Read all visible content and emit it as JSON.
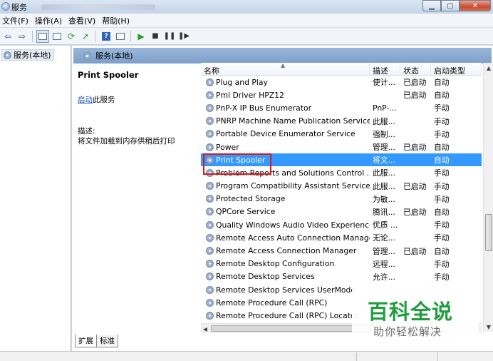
{
  "window": {
    "title": "服务"
  },
  "menu": [
    "文件(F)",
    "操作(A)",
    "查看(V)",
    "帮助(H)"
  ],
  "toolbar": {
    "icons": [
      "back-arrow",
      "forward-arrow",
      "console-tree",
      "properties",
      "refresh",
      "export",
      "help",
      "view",
      "start",
      "stop",
      "pause",
      "restart"
    ]
  },
  "tree": {
    "root": "服务(本地)"
  },
  "panel": {
    "header": "服务(本地)"
  },
  "detail": {
    "service_name": "Print Spooler",
    "start_link": "启动",
    "start_suffix": "此服务",
    "desc_label": "描述:",
    "desc_text": "将文件加载到内存供稍后打印"
  },
  "columns": {
    "name": "名称",
    "desc": "描述",
    "status": "状态",
    "start": "启动类型"
  },
  "rows": [
    {
      "name": "Plug and Play",
      "desc": "使计...",
      "status": "已启动",
      "start": "自动"
    },
    {
      "name": "Pml Driver HPZ12",
      "desc": "",
      "status": "已启动",
      "start": "自动"
    },
    {
      "name": "PnP-X IP Bus Enumerator",
      "desc": "PnP-...",
      "status": "",
      "start": "手动"
    },
    {
      "name": "PNRP Machine Name Publication Service",
      "desc": "此服...",
      "status": "",
      "start": "手动"
    },
    {
      "name": "Portable Device Enumerator Service",
      "desc": "强制...",
      "status": "",
      "start": "手动"
    },
    {
      "name": "Power",
      "desc": "管理...",
      "status": "已启动",
      "start": "自动"
    },
    {
      "name": "Print Spooler",
      "desc": "将文...",
      "status": "",
      "start": "自动"
    },
    {
      "name": "Problem Reports and Solutions Control ...",
      "desc": "此服...",
      "status": "",
      "start": "手动"
    },
    {
      "name": "Program Compatibility Assistant Service",
      "desc": "此服...",
      "status": "已启动",
      "start": "手动"
    },
    {
      "name": "Protected Storage",
      "desc": "为敏...",
      "status": "",
      "start": "手动"
    },
    {
      "name": "QPCore Service",
      "desc": "腾讯...",
      "status": "已启动",
      "start": "自动"
    },
    {
      "name": "Quality Windows Audio Video Experience",
      "desc": "优质 ...",
      "status": "",
      "start": "手动"
    },
    {
      "name": "Remote Access Auto Connection Manager",
      "desc": "无论...",
      "status": "",
      "start": "手动"
    },
    {
      "name": "Remote Access Connection Manager",
      "desc": "管理...",
      "status": "已启动",
      "start": "自动"
    },
    {
      "name": "Remote Desktop Configuration",
      "desc": "远程...",
      "status": "",
      "start": "手动"
    },
    {
      "name": "Remote Desktop Services",
      "desc": "允许...",
      "status": "",
      "start": "手动"
    },
    {
      "name": "Remote Desktop Services UserMode",
      "desc": "",
      "status": "",
      "start": ""
    },
    {
      "name": "Remote Procedure Call (RPC)",
      "desc": "",
      "status": "",
      "start": ""
    },
    {
      "name": "Remote Procedure Call (RPC) Locator",
      "desc": "",
      "status": "",
      "start": ""
    }
  ],
  "tabs": [
    "扩展",
    "标准"
  ],
  "watermark": {
    "title": "百科全说",
    "subtitle": "助你轻松解决"
  }
}
